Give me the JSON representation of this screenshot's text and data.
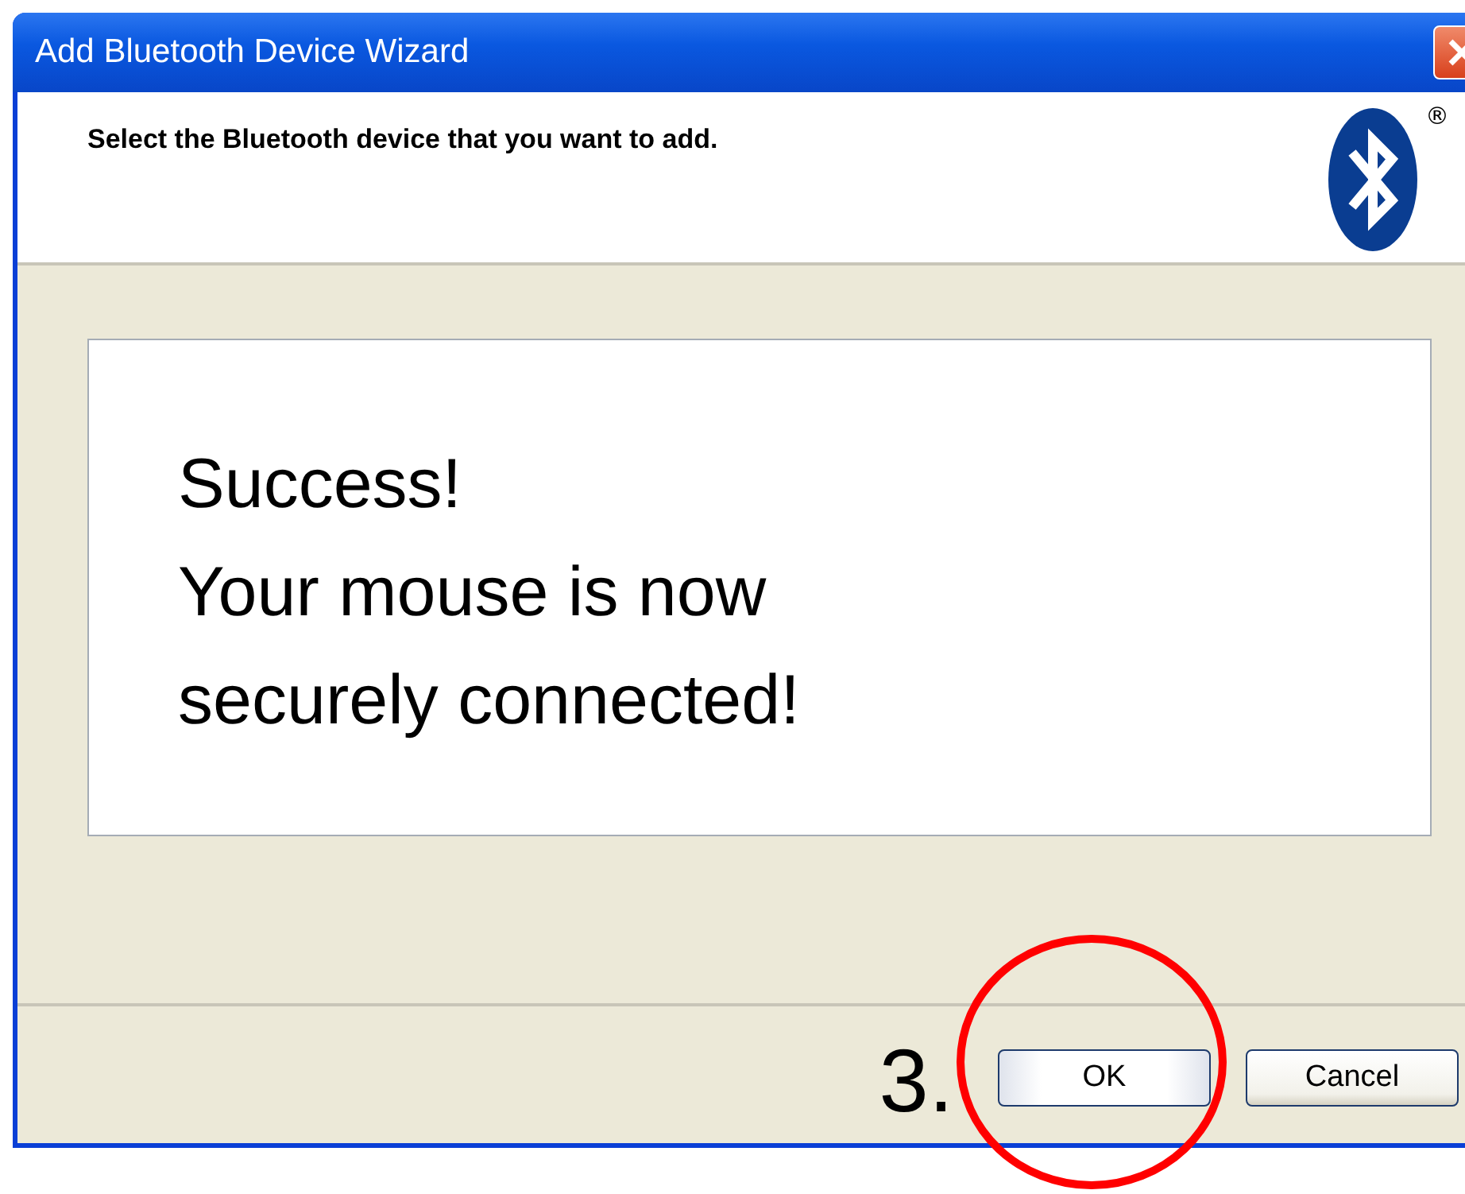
{
  "window": {
    "title": "Add Bluetooth Device Wizard"
  },
  "header": {
    "instruction": "Select the Bluetooth device that you want to add.",
    "trademark": "®"
  },
  "message": {
    "lines": [
      "Success!",
      "Your mouse is now",
      "securely connected!"
    ]
  },
  "annotation": {
    "step": "3."
  },
  "buttons": [
    {
      "label": "OK",
      "highlighted": true
    },
    {
      "label": "Cancel",
      "highlighted": false
    }
  ]
}
